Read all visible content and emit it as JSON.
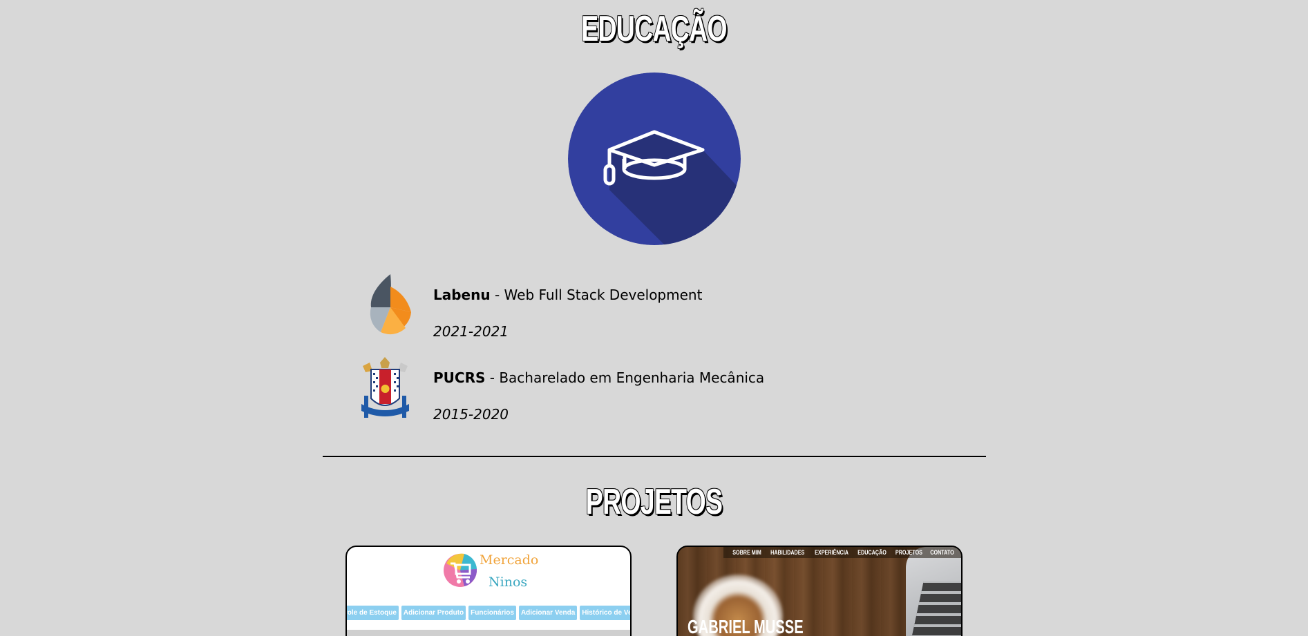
{
  "education": {
    "title": "EDUCAÇÃO",
    "logo_icon": "graduation-cap-icon",
    "logo_color": "#323f9f",
    "items": [
      {
        "institution": "Labenu",
        "separator": " - ",
        "course": "Web Full Stack Development",
        "period": "2021-2021",
        "logo_icon": "labenu-logo-icon"
      },
      {
        "institution": "PUCRS",
        "separator": " - ",
        "course": "Bacharelado em Engenharia Mecânica",
        "period": "2015-2020",
        "logo_icon": "pucrs-crest-icon"
      }
    ]
  },
  "projects": {
    "title": "PROJETOS",
    "cards": [
      {
        "logo_line1": "Mercado",
        "logo_line2": "Ninos",
        "nav": [
          "Controle de Estoque",
          "Adicionar Produto",
          "Funcionários",
          "Adicionar Venda",
          "Histórico de Vendas"
        ],
        "accent": "#8ccff0"
      },
      {
        "nav": [
          "SOBRE MIM",
          "HABILIDADES",
          "EXPERIÊNCIA",
          "EDUCAÇÃO",
          "PROJETOS",
          "CONTATO"
        ],
        "name": "GABRIEL MUSSE"
      }
    ]
  }
}
